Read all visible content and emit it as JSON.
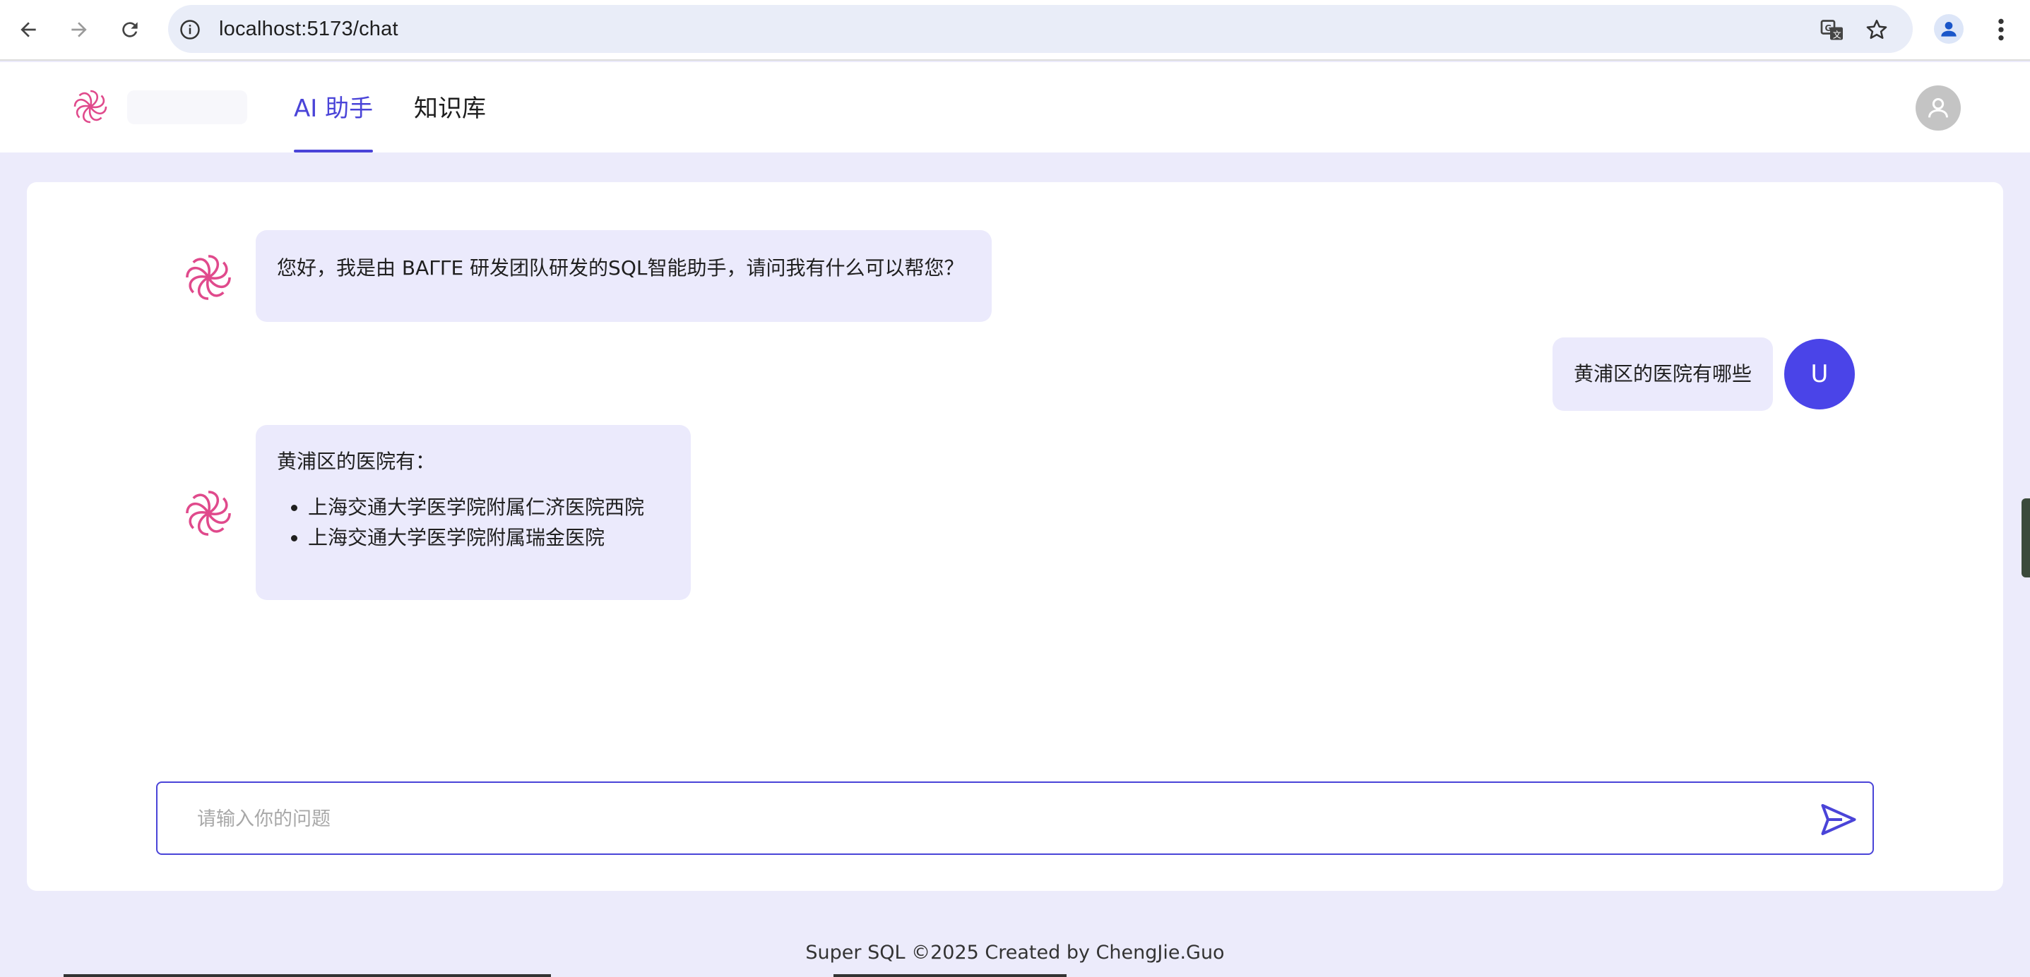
{
  "browser": {
    "url": "localhost:5173/chat",
    "icons": [
      "back-arrow-icon",
      "forward-arrow-icon",
      "reload-icon",
      "info-icon",
      "translate-icon",
      "star-icon",
      "profile-icon",
      "more-vert-icon"
    ]
  },
  "header": {
    "tabs": [
      {
        "label": "AI 助手",
        "active": true
      },
      {
        "label": "知识库",
        "active": false
      }
    ],
    "accent_color": "#4a44d8"
  },
  "chat": {
    "messages": [
      {
        "role": "assistant",
        "text": "您好，我是由 ΒΑΓΓΕ 研发团队研发的SQL智能助手，请问我有什么可以帮您？"
      },
      {
        "role": "user",
        "avatar_letter": "U",
        "text": "黄浦区的医院有哪些"
      },
      {
        "role": "assistant",
        "text": "黄浦区的医院有：",
        "list": [
          "上海交通大学医学院附属仁济医院西院",
          "上海交通大学医学院附属瑞金医院"
        ]
      }
    ],
    "input_placeholder": "请输入你的问题"
  },
  "footer": {
    "text": "Super SQL ©2025 Created by ChengJie.Guo"
  }
}
